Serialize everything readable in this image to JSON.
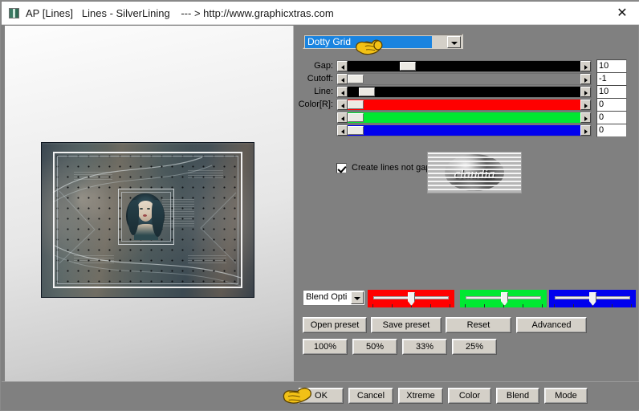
{
  "window": {
    "app_title": "AP [Lines]",
    "plugin_title": "Lines - SilverLining",
    "url": "--- > http://www.graphicxtras.com",
    "close_label": "✕"
  },
  "preset": {
    "selected": "Dotty Grid"
  },
  "sliders": [
    {
      "label": "Gap:",
      "value": "10",
      "fill": "#000000",
      "thumb_pct": 24
    },
    {
      "label": "Cutoff:",
      "value": "-1",
      "fill": "#808080",
      "thumb_pct": 0
    },
    {
      "label": "Line:",
      "value": "10",
      "fill": "#000000",
      "thumb_pct": 5
    },
    {
      "label": "Color[R]:",
      "value": "0",
      "fill": "#ff0000",
      "thumb_pct": 0
    },
    {
      "label": "",
      "value": "0",
      "fill": "#00e832",
      "thumb_pct": 0
    },
    {
      "label": "",
      "value": "0",
      "fill": "#0000ee",
      "thumb_pct": 0
    }
  ],
  "checkbox": {
    "label": "Create lines not gaps",
    "checked": true
  },
  "logo": {
    "text": "claudia"
  },
  "blend": {
    "combo_label": "Blend Opti",
    "channels": [
      {
        "name": "red",
        "color": "#ff0000",
        "thumb_pct": 50
      },
      {
        "name": "green",
        "color": "#00e832",
        "thumb_pct": 52
      },
      {
        "name": "blue",
        "color": "#0000ee",
        "thumb_pct": 50
      }
    ]
  },
  "preset_buttons": [
    {
      "label": "Open preset"
    },
    {
      "label": "Save preset"
    },
    {
      "label": "Reset"
    },
    {
      "label": "Advanced"
    }
  ],
  "zoom_buttons": [
    {
      "label": "100%"
    },
    {
      "label": "50%"
    },
    {
      "label": "33%"
    },
    {
      "label": "25%"
    }
  ],
  "zoom_stepper": {
    "increase": "+",
    "value": "25%",
    "decrease": "−"
  },
  "status_bar_color": "#3d9bf0",
  "action_buttons": [
    {
      "label": "OK"
    },
    {
      "label": "Cancel"
    },
    {
      "label": "Xtreme"
    },
    {
      "label": "Color"
    },
    {
      "label": "Blend"
    },
    {
      "label": "Mode"
    }
  ],
  "colors": {
    "panel_gray": "#808080",
    "button_face": "#d4d0c8",
    "selection_blue": "#1a84e0",
    "titlebar": "#ffffff"
  }
}
